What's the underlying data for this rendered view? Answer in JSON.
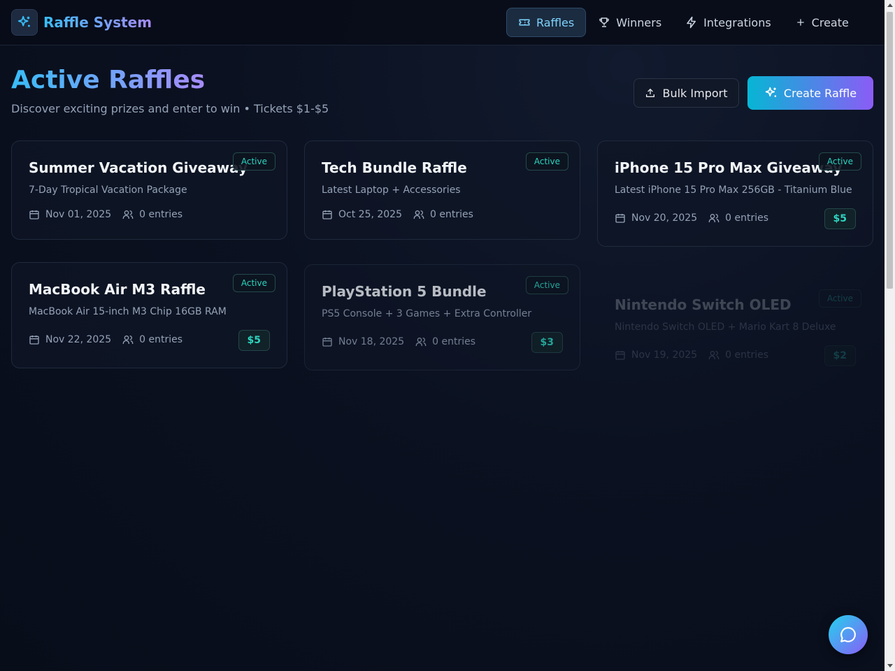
{
  "app": {
    "title": "Raffle System"
  },
  "nav": [
    {
      "label": "Raffles",
      "icon": "ticket-icon",
      "active": true
    },
    {
      "label": "Winners",
      "icon": "trophy-icon",
      "active": false
    },
    {
      "label": "Integrations",
      "icon": "lightning-icon",
      "active": false
    },
    {
      "label": "Create",
      "icon": "plus-icon",
      "active": false
    }
  ],
  "page": {
    "title": "Active Raffles",
    "subtitle": "Discover exciting prizes and enter to win • Tickets $1-$5",
    "bulk_import_label": "Bulk Import",
    "create_label": "Create Raffle"
  },
  "raffles": [
    {
      "title": "Summer Vacation Giveaway",
      "description": "7-Day Tropical Vacation Package",
      "status": "Active",
      "date": "Nov 01, 2025",
      "entries": "0 entries",
      "price": ""
    },
    {
      "title": "Tech Bundle Raffle",
      "description": "Latest Laptop + Accessories",
      "status": "Active",
      "date": "Oct 25, 2025",
      "entries": "0 entries",
      "price": ""
    },
    {
      "title": "iPhone 15 Pro Max Giveaway",
      "description": "Latest iPhone 15 Pro Max 256GB - Titanium Blue",
      "status": "Active",
      "date": "Nov 20, 2025",
      "entries": "0 entries",
      "price": "$5"
    },
    {
      "title": "MacBook Air M3 Raffle",
      "description": "MacBook Air 15-inch M3 Chip 16GB RAM",
      "status": "Active",
      "date": "Nov 22, 2025",
      "entries": "0 entries",
      "price": "$5"
    },
    {
      "title": "PlayStation 5 Bundle",
      "description": "PS5 Console + 3 Games + Extra Controller",
      "status": "Active",
      "date": "Nov 18, 2025",
      "entries": "0 entries",
      "price": "$3"
    },
    {
      "title": "Nintendo Switch OLED",
      "description": "Nintendo Switch OLED + Mario Kart 8 Deluxe",
      "status": "Active",
      "date": "Nov 19, 2025",
      "entries": "0 entries",
      "price": "$2"
    }
  ],
  "colors": {
    "accent_cyan": "#38bdf8",
    "accent_violet": "#a78bfa",
    "badge_teal": "#2dd4bf",
    "background": "#0b1120"
  },
  "icons": {
    "logo": "sparkles-icon",
    "upload": "upload-icon",
    "calendar": "calendar-icon",
    "users": "users-icon",
    "chat": "chat-bubble-icon"
  }
}
